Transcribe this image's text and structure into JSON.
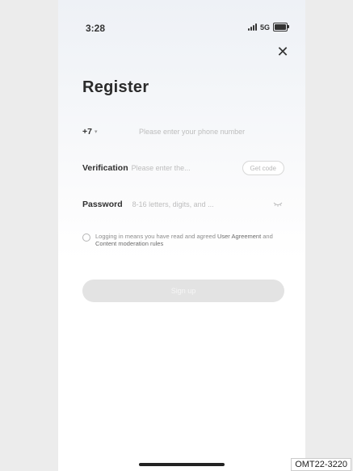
{
  "status_bar": {
    "time": "3:28",
    "network": "5G"
  },
  "title": "Register",
  "phone_row": {
    "country_code": "+7",
    "placeholder": "Please enter your phone number"
  },
  "verification_row": {
    "label": "Verification",
    "placeholder": "Please enter the...",
    "button_label": "Get code"
  },
  "password_row": {
    "label": "Password",
    "placeholder": "8-16 letters, digits, and ..."
  },
  "agreement": {
    "prefix": "Logging in means you have read and agreed",
    "link1": "User Agreement",
    "and": " and ",
    "link2": "Content moderation rules"
  },
  "register_button": "Sign up",
  "watermark": "OMT22-3220",
  "colors": {
    "background": "#ececec",
    "button_disabled": "#e3e3e3",
    "title": "#2b2b2b",
    "placeholder": "#bdbdbd"
  },
  "icons": {
    "close": "close-icon",
    "password_visibility": "eye-closed-icon",
    "checkbox": "checkbox-unchecked-icon"
  }
}
